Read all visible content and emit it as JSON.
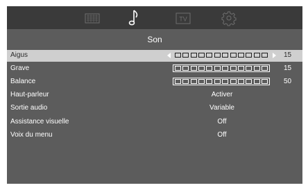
{
  "tabs": [
    {
      "name": "picture",
      "icon": "picture-grid-icon"
    },
    {
      "name": "sound",
      "icon": "music-note-icon",
      "active": true
    },
    {
      "name": "tv",
      "icon": "tv-icon",
      "label": "TV"
    },
    {
      "name": "settings",
      "icon": "gear-icon"
    }
  ],
  "section_title": "Son",
  "rows": [
    {
      "label": "Aigus",
      "type": "slider",
      "value": "15",
      "segments": 12,
      "selected": true
    },
    {
      "label": "Grave",
      "type": "slider",
      "value": "15",
      "segments": 12
    },
    {
      "label": "Balance",
      "type": "slider",
      "value": "50",
      "segments": 12
    },
    {
      "label": "Haut-parleur",
      "type": "option",
      "value": "Activer"
    },
    {
      "label": "Sortie audio",
      "type": "option",
      "value": "Variable"
    },
    {
      "label": "Assistance visuelle",
      "type": "option",
      "value": "Off"
    },
    {
      "label": "Voix du menu",
      "type": "option",
      "value": "Off"
    }
  ],
  "colors": {
    "panel": "#5c5c5c",
    "topbar": "#3a3a3a",
    "selected_row": "#cfcfcf",
    "text": "#ffffff"
  }
}
